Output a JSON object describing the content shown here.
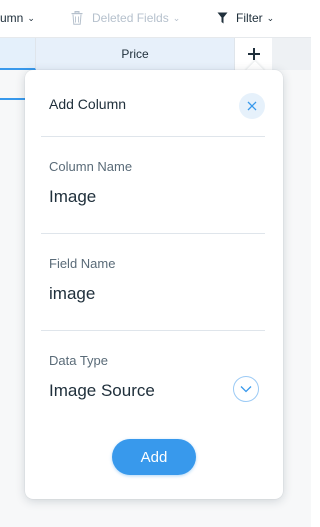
{
  "toolbar": {
    "column_label": "umn",
    "deleted_fields_label": "Deleted Fields",
    "filter_label": "Filter"
  },
  "columns": {
    "price_label": "Price"
  },
  "panel": {
    "title": "Add Column",
    "column_name_label": "Column Name",
    "column_name_value": "Image",
    "field_name_label": "Field Name",
    "field_name_value": "image",
    "data_type_label": "Data Type",
    "data_type_value": "Image Source",
    "add_button_label": "Add"
  },
  "icons": {
    "deleted": "trash-icon",
    "filter": "filter-icon",
    "add_column": "plus-icon",
    "close": "close-icon",
    "dropdown": "chevron-down-icon"
  },
  "colors": {
    "accent": "#3899ec",
    "text": "#20303c",
    "muted": "#5a6b78",
    "disabled": "#b6c1cd"
  }
}
